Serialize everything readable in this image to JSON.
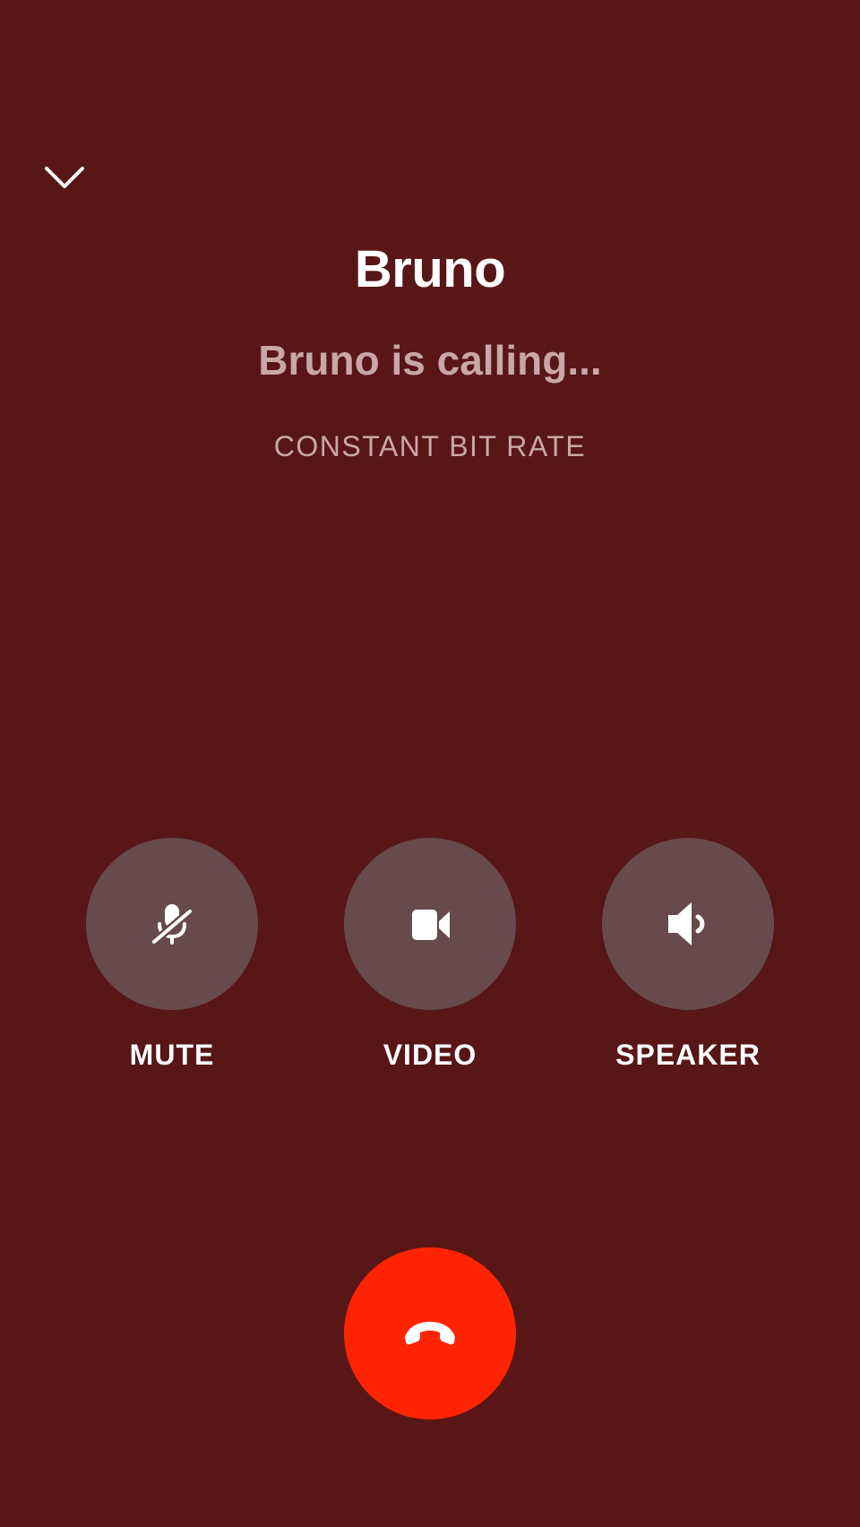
{
  "call": {
    "caller_name": "Bruno",
    "status_text": "Bruno is calling...",
    "bitrate_mode": "CONSTANT BIT RATE"
  },
  "controls": [
    {
      "label": "MUTE",
      "icon": "microphone-muted-icon"
    },
    {
      "label": "VIDEO",
      "icon": "video-camera-icon"
    },
    {
      "label": "SPEAKER",
      "icon": "speaker-icon"
    }
  ],
  "actions": {
    "minimize_icon": "chevron-down-icon",
    "hangup_icon": "phone-hangup-icon"
  },
  "colors": {
    "background": "#581616",
    "control_button": "#674a4b",
    "secondary_text": "#c9a7a7",
    "hangup": "#fe2402",
    "text": "#ffffff"
  }
}
